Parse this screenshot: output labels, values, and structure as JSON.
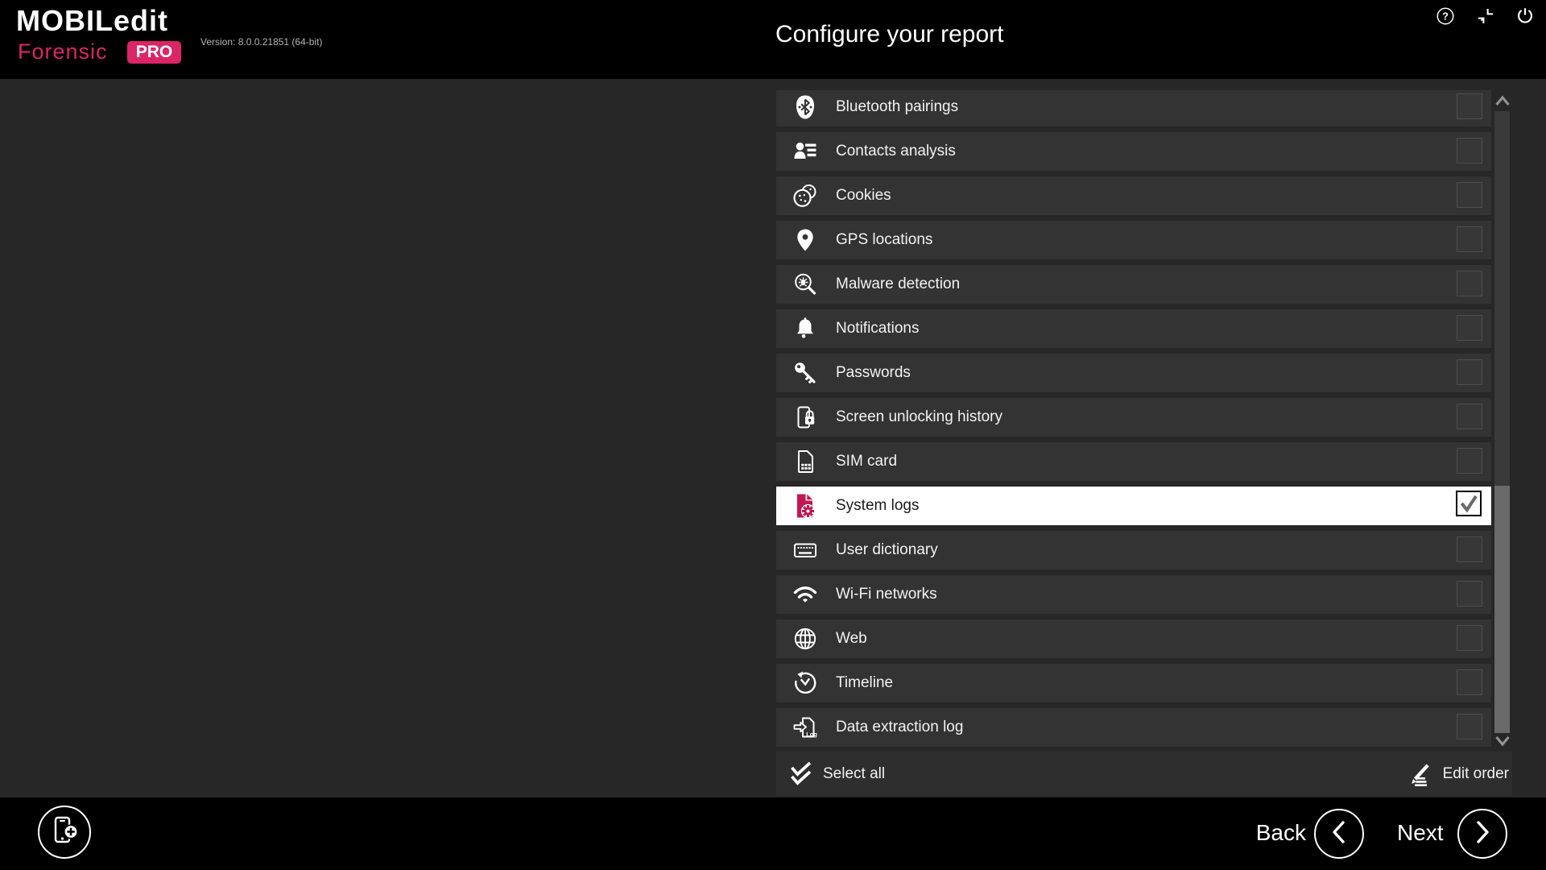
{
  "app": {
    "name_line1": "MOBILedit",
    "name_line2": "Forensic",
    "badge": "PRO",
    "version": "Version: 8.0.0.21851 (64-bit)"
  },
  "header": {
    "title": "Configure your report",
    "icons": [
      "help-icon",
      "restore-window-icon",
      "power-icon"
    ]
  },
  "report_items": [
    {
      "label": "Bluetooth pairings",
      "icon": "bluetooth-icon",
      "checked": false,
      "highlighted": false
    },
    {
      "label": "Contacts analysis",
      "icon": "contacts-analysis-icon",
      "checked": false,
      "highlighted": false
    },
    {
      "label": "Cookies",
      "icon": "cookies-icon",
      "checked": false,
      "highlighted": false
    },
    {
      "label": "GPS locations",
      "icon": "gps-locations-icon",
      "checked": false,
      "highlighted": false
    },
    {
      "label": "Malware detection",
      "icon": "malware-detection-icon",
      "checked": false,
      "highlighted": false
    },
    {
      "label": "Notifications",
      "icon": "notifications-icon",
      "checked": false,
      "highlighted": false
    },
    {
      "label": "Passwords",
      "icon": "passwords-icon",
      "checked": false,
      "highlighted": false
    },
    {
      "label": "Screen unlocking history",
      "icon": "screen-unlocking-icon",
      "checked": false,
      "highlighted": false
    },
    {
      "label": "SIM card",
      "icon": "sim-card-icon",
      "checked": false,
      "highlighted": false
    },
    {
      "label": "System logs",
      "icon": "system-logs-icon",
      "checked": true,
      "highlighted": true
    },
    {
      "label": "User dictionary",
      "icon": "user-dictionary-icon",
      "checked": false,
      "highlighted": false
    },
    {
      "label": "Wi-Fi networks",
      "icon": "wifi-icon",
      "checked": false,
      "highlighted": false
    },
    {
      "label": "Web",
      "icon": "web-icon",
      "checked": false,
      "highlighted": false
    },
    {
      "label": "Timeline",
      "icon": "timeline-icon",
      "checked": false,
      "highlighted": false
    },
    {
      "label": "Data extraction log",
      "icon": "data-extraction-log-icon",
      "checked": false,
      "highlighted": false
    }
  ],
  "list_footer": {
    "select_all_label": "Select all",
    "edit_order_label": "Edit order"
  },
  "footer": {
    "back_label": "Back",
    "next_label": "Next"
  },
  "colors": {
    "brand_pink": "#da2567",
    "system_logs_icon_pink": "#c41650",
    "header_bg": "#000000",
    "content_bg": "#272727",
    "row_bg": "#333333",
    "highlight_row_bg": "#ffffff",
    "row_text": "#f2f2f2",
    "highlight_row_text": "#1a1a1a",
    "scrollbar_track": "#3a3a3a",
    "scrollbar_thumb": "#696969"
  }
}
